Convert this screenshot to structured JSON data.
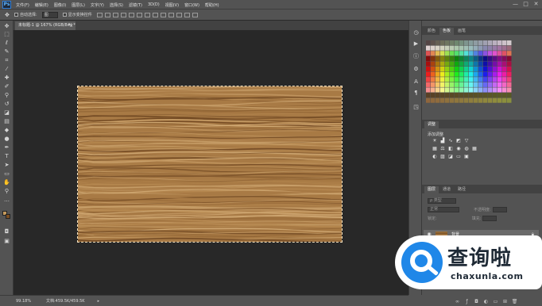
{
  "app": {
    "logo": "Ps"
  },
  "menu": {
    "items": [
      "文件(F)",
      "编辑(E)",
      "图像(I)",
      "图层(L)",
      "文字(Y)",
      "选择(S)",
      "滤镜(T)",
      "3D(D)",
      "视图(V)",
      "窗口(W)",
      "帮助(H)"
    ]
  },
  "window_controls": {
    "minimize": "—",
    "maximize": "□",
    "close": "✕"
  },
  "options": {
    "auto_select_label": "自动选择:",
    "auto_select_value": "图",
    "show_transform_label": "显示变换控件"
  },
  "document": {
    "tab_title": "未标题-1 @ 167% (RGB/8#) *",
    "tab_close": "×",
    "zoom": "99.18%",
    "doc_info": "文档:459.5K/459.5K",
    "status_arrow": "▸"
  },
  "panels": {
    "swatches_tabs": [
      "颜色",
      "色板",
      "画笔"
    ],
    "adjustments_tab": "调整",
    "adjustments_title": "添加调整",
    "layers_tabs": [
      "图层",
      "通道",
      "路径"
    ],
    "layer_kind": "ρ 类型",
    "layer_mode": "正常",
    "layer_opacity_label": "不透明度:",
    "layer_lock_label": "锁定:",
    "layer_fill_label": "填充:",
    "layer_name": "背景"
  },
  "colors": {
    "wood_light": "#c9a06a",
    "wood_mid": "#a87a45",
    "wood_dark": "#6e4621",
    "ps_blue": "#1f87e8"
  },
  "watermark": {
    "brand_cn": "查询啦",
    "brand_url": "chaxunla.com"
  }
}
